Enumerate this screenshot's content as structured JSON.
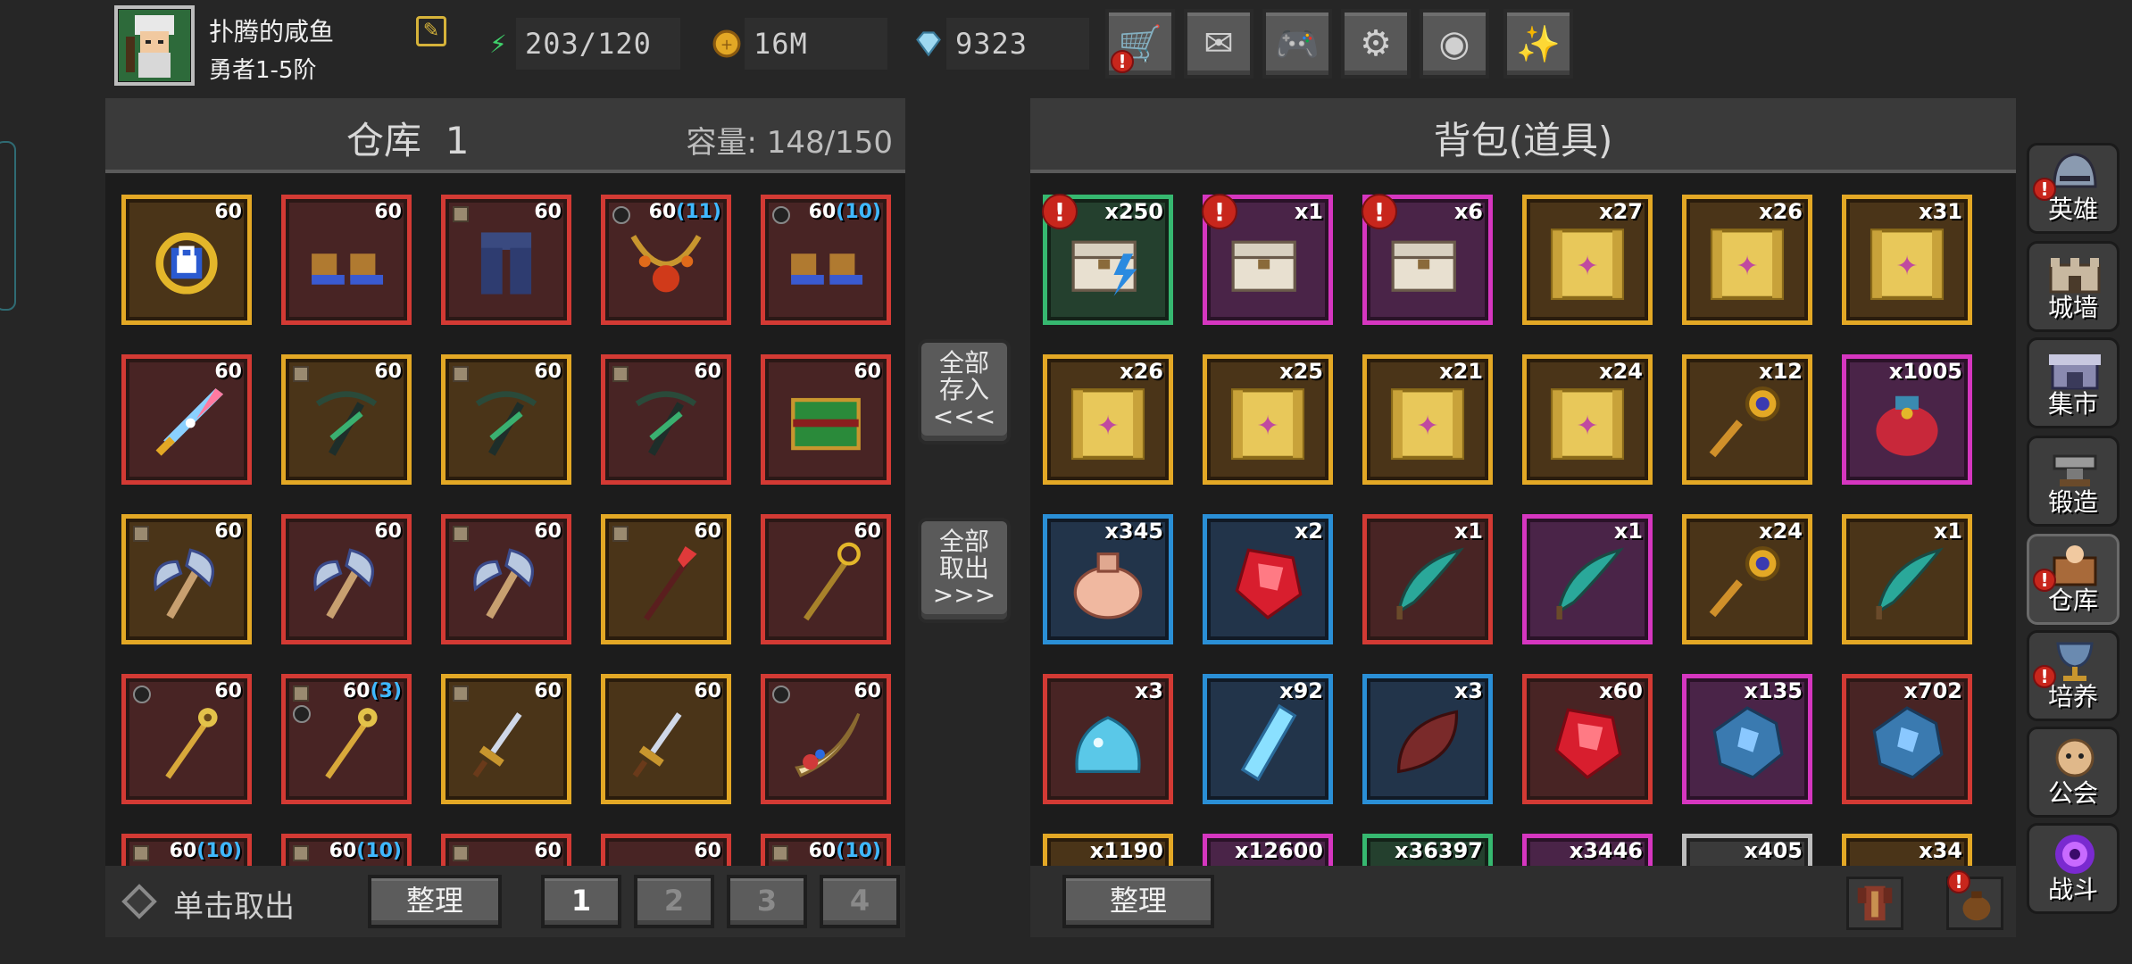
{
  "player": {
    "name": "扑腾的咸鱼",
    "rank": "勇者1-5阶"
  },
  "resources": {
    "energy": "203/120",
    "gold": "16M",
    "gems": "9323"
  },
  "top_buttons": [
    {
      "name": "shop-cart-icon",
      "glyph": "🛒",
      "alert": "!"
    },
    {
      "name": "mail-icon",
      "glyph": "✉",
      "alert": ""
    },
    {
      "name": "gamepad-icon",
      "glyph": "🎮",
      "alert": ""
    },
    {
      "name": "gear-icon",
      "glyph": "⚙",
      "alert": ""
    },
    {
      "name": "color-wheel-icon",
      "glyph": "◉",
      "alert": ""
    },
    {
      "name": "party-popper-icon",
      "glyph": "✨",
      "alert": ""
    }
  ],
  "warehouse": {
    "title": "仓库",
    "number": "1",
    "capacity_label": "容量:",
    "capacity": "148/150",
    "click_label": "单击取出",
    "sort_label": "整理",
    "pages": [
      "1",
      "2",
      "3",
      "4"
    ],
    "active_page": "1"
  },
  "transfer": {
    "deposit_all": "全部\n存入\n<<<",
    "withdraw_all": "全部\n取出\n>>>"
  },
  "bag": {
    "title": "背包(道具)",
    "sort_label": "整理"
  },
  "warehouse_items": [
    {
      "name": "locked-amulet",
      "frame": "gold",
      "level": "60",
      "plus": "",
      "lock": false,
      "ring": false,
      "icon": "amulet-icon"
    },
    {
      "name": "boots",
      "frame": "red",
      "level": "60",
      "plus": "",
      "lock": false,
      "ring": false,
      "icon": "boots-icon"
    },
    {
      "name": "pants",
      "frame": "red",
      "level": "60",
      "plus": "",
      "lock": true,
      "ring": false,
      "icon": "pants-icon"
    },
    {
      "name": "necklace",
      "frame": "red",
      "level": "60",
      "plus": "(11)",
      "lock": false,
      "ring": true,
      "icon": "necklace-icon"
    },
    {
      "name": "red-boots",
      "frame": "red",
      "level": "60",
      "plus": "(10)",
      "lock": false,
      "ring": true,
      "icon": "boots-icon"
    },
    {
      "name": "rainbow-sword",
      "frame": "red",
      "level": "60",
      "plus": "",
      "lock": false,
      "ring": false,
      "icon": "sword-icon"
    },
    {
      "name": "crossbow-1",
      "frame": "gold",
      "level": "60",
      "plus": "",
      "lock": true,
      "ring": false,
      "icon": "crossbow-icon"
    },
    {
      "name": "crossbow-2",
      "frame": "gold",
      "level": "60",
      "plus": "",
      "lock": true,
      "ring": false,
      "icon": "crossbow-icon"
    },
    {
      "name": "crossbow-3",
      "frame": "red",
      "level": "60",
      "plus": "",
      "lock": true,
      "ring": false,
      "icon": "crossbow-icon"
    },
    {
      "name": "green-book",
      "frame": "red",
      "level": "60",
      "plus": "",
      "lock": false,
      "ring": false,
      "icon": "book-icon"
    },
    {
      "name": "blue-axe",
      "frame": "gold",
      "level": "60",
      "plus": "",
      "lock": true,
      "ring": false,
      "icon": "axe-icon"
    },
    {
      "name": "double-axe",
      "frame": "red",
      "level": "60",
      "plus": "",
      "lock": false,
      "ring": false,
      "icon": "axe-icon"
    },
    {
      "name": "red-axe",
      "frame": "red",
      "level": "60",
      "plus": "",
      "lock": true,
      "ring": false,
      "icon": "axe-icon"
    },
    {
      "name": "red-spear",
      "frame": "gold",
      "level": "60",
      "plus": "",
      "lock": true,
      "ring": false,
      "icon": "spear-icon"
    },
    {
      "name": "gold-staff",
      "frame": "red",
      "level": "60",
      "plus": "",
      "lock": false,
      "ring": false,
      "icon": "staff-icon"
    },
    {
      "name": "locked-scepter",
      "frame": "red",
      "level": "60",
      "plus": "",
      "lock": false,
      "ring": true,
      "icon": "scepter-icon"
    },
    {
      "name": "gold-scepter",
      "frame": "red",
      "level": "60",
      "plus": "(3)",
      "lock": true,
      "ring": true,
      "icon": "scepter-icon"
    },
    {
      "name": "locked-dagger",
      "frame": "gold",
      "level": "60",
      "plus": "",
      "lock": true,
      "ring": false,
      "icon": "dagger-icon"
    },
    {
      "name": "dagger",
      "frame": "gold",
      "level": "60",
      "plus": "",
      "lock": false,
      "ring": false,
      "icon": "dagger-icon"
    },
    {
      "name": "curved-blade",
      "frame": "red",
      "level": "60",
      "plus": "",
      "lock": false,
      "ring": true,
      "icon": "blade-icon"
    },
    {
      "name": "item-21",
      "frame": "red",
      "level": "60",
      "plus": "(10)",
      "lock": true,
      "ring": false,
      "icon": "item-icon"
    },
    {
      "name": "item-22",
      "frame": "red",
      "level": "60",
      "plus": "(10)",
      "lock": true,
      "ring": false,
      "icon": "item-icon"
    },
    {
      "name": "item-23",
      "frame": "red",
      "level": "60",
      "plus": "",
      "lock": true,
      "ring": false,
      "icon": "item-icon"
    },
    {
      "name": "item-24",
      "frame": "red",
      "level": "60",
      "plus": "",
      "lock": false,
      "ring": false,
      "icon": "item-icon"
    },
    {
      "name": "item-25",
      "frame": "red",
      "level": "60",
      "plus": "(10)",
      "lock": true,
      "ring": false,
      "icon": "item-icon"
    }
  ],
  "bag_items": [
    {
      "name": "energy-chest",
      "frame": "green",
      "count": "x250",
      "alert": "!",
      "icon": "chest-icon"
    },
    {
      "name": "s-chest",
      "frame": "magenta",
      "count": "x1",
      "alert": "!",
      "icon": "chest-icon"
    },
    {
      "name": "gem-chest",
      "frame": "magenta",
      "count": "x6",
      "alert": "!",
      "icon": "chest-icon"
    },
    {
      "name": "scroll-1",
      "frame": "gold",
      "count": "x27",
      "alert": "",
      "icon": "scroll-icon"
    },
    {
      "name": "scroll-2",
      "frame": "gold",
      "count": "x26",
      "alert": "",
      "icon": "scroll-icon"
    },
    {
      "name": "scroll-3",
      "frame": "gold",
      "count": "x31",
      "alert": "",
      "icon": "scroll-icon"
    },
    {
      "name": "scroll-4",
      "frame": "gold",
      "count": "x26",
      "alert": "",
      "icon": "scroll-icon"
    },
    {
      "name": "scroll-5",
      "frame": "gold",
      "count": "x25",
      "alert": "",
      "icon": "scroll-icon"
    },
    {
      "name": "scroll-6",
      "frame": "gold",
      "count": "x21",
      "alert": "",
      "icon": "scroll-icon"
    },
    {
      "name": "scroll-7",
      "frame": "gold",
      "count": "x24",
      "alert": "",
      "icon": "scroll-icon"
    },
    {
      "name": "gold-key",
      "frame": "gold",
      "count": "x12",
      "alert": "",
      "icon": "key-icon"
    },
    {
      "name": "red-pouch",
      "frame": "magenta",
      "count": "x1005",
      "alert": "",
      "icon": "pouch-icon"
    },
    {
      "name": "cloth-sack",
      "frame": "blue",
      "count": "x345",
      "alert": "",
      "icon": "sack-icon"
    },
    {
      "name": "red-crystal",
      "frame": "blue",
      "count": "x2",
      "alert": "",
      "icon": "crystal-icon"
    },
    {
      "name": "teal-feather",
      "frame": "red",
      "count": "x1",
      "alert": "",
      "icon": "feather-icon"
    },
    {
      "name": "green-feather",
      "frame": "magenta",
      "count": "x1",
      "alert": "",
      "icon": "feather-icon"
    },
    {
      "name": "silver-key",
      "frame": "gold",
      "count": "x24",
      "alert": "",
      "icon": "key-icon"
    },
    {
      "name": "brown-feather",
      "frame": "gold",
      "count": "x1",
      "alert": "",
      "icon": "feather-icon"
    },
    {
      "name": "blue-slime",
      "frame": "red",
      "count": "x3",
      "alert": "",
      "icon": "slime-icon"
    },
    {
      "name": "ice-shard",
      "frame": "blue",
      "count": "x92",
      "alert": "",
      "icon": "shard-icon"
    },
    {
      "name": "dark-leaf",
      "frame": "blue",
      "count": "x3",
      "alert": "",
      "icon": "leaf-icon"
    },
    {
      "name": "rainbow-crystal",
      "frame": "red",
      "count": "x60",
      "alert": "",
      "icon": "crystal-icon"
    },
    {
      "name": "blue-ore",
      "frame": "magenta",
      "count": "x135",
      "alert": "",
      "icon": "ore-icon"
    },
    {
      "name": "green-ore",
      "frame": "red",
      "count": "x702",
      "alert": "",
      "icon": "ore-icon"
    },
    {
      "name": "bag-item-25",
      "frame": "gold",
      "count": "x1190",
      "alert": "",
      "icon": "item-icon"
    },
    {
      "name": "bag-item-26",
      "frame": "magenta",
      "count": "x12600",
      "alert": "",
      "icon": "item-icon"
    },
    {
      "name": "bag-item-27",
      "frame": "green",
      "count": "x36397",
      "alert": "",
      "icon": "item-icon"
    },
    {
      "name": "bag-item-28",
      "frame": "magenta",
      "count": "x3446",
      "alert": "",
      "icon": "item-icon"
    },
    {
      "name": "bag-item-29",
      "frame": "grey",
      "count": "x405",
      "alert": "",
      "icon": "item-icon"
    },
    {
      "name": "bag-item-30",
      "frame": "gold",
      "count": "x34",
      "alert": "",
      "icon": "item-icon"
    }
  ],
  "side_nav": [
    {
      "label": "英雄",
      "alert": "!",
      "icon": "helmet-icon"
    },
    {
      "label": "城墙",
      "alert": "",
      "icon": "castle-wall-icon"
    },
    {
      "label": "集市",
      "alert": "",
      "icon": "market-icon"
    },
    {
      "label": "锻造",
      "alert": "",
      "icon": "anvil-icon"
    },
    {
      "label": "仓库",
      "alert": "!",
      "icon": "warehouse-icon"
    },
    {
      "label": "培养",
      "alert": "!",
      "icon": "chalice-icon"
    },
    {
      "label": "公会",
      "alert": "",
      "icon": "guild-icon"
    },
    {
      "label": "战斗",
      "alert": "",
      "icon": "portal-icon"
    }
  ],
  "colors": {
    "frame_gold": "#e3a825",
    "frame_red": "#d33a34",
    "frame_magenta": "#d636c0",
    "frame_green": "#36b870",
    "frame_blue": "#2a8fd6",
    "plus_level": "#3fb8ff",
    "alert": "#c8261c"
  }
}
